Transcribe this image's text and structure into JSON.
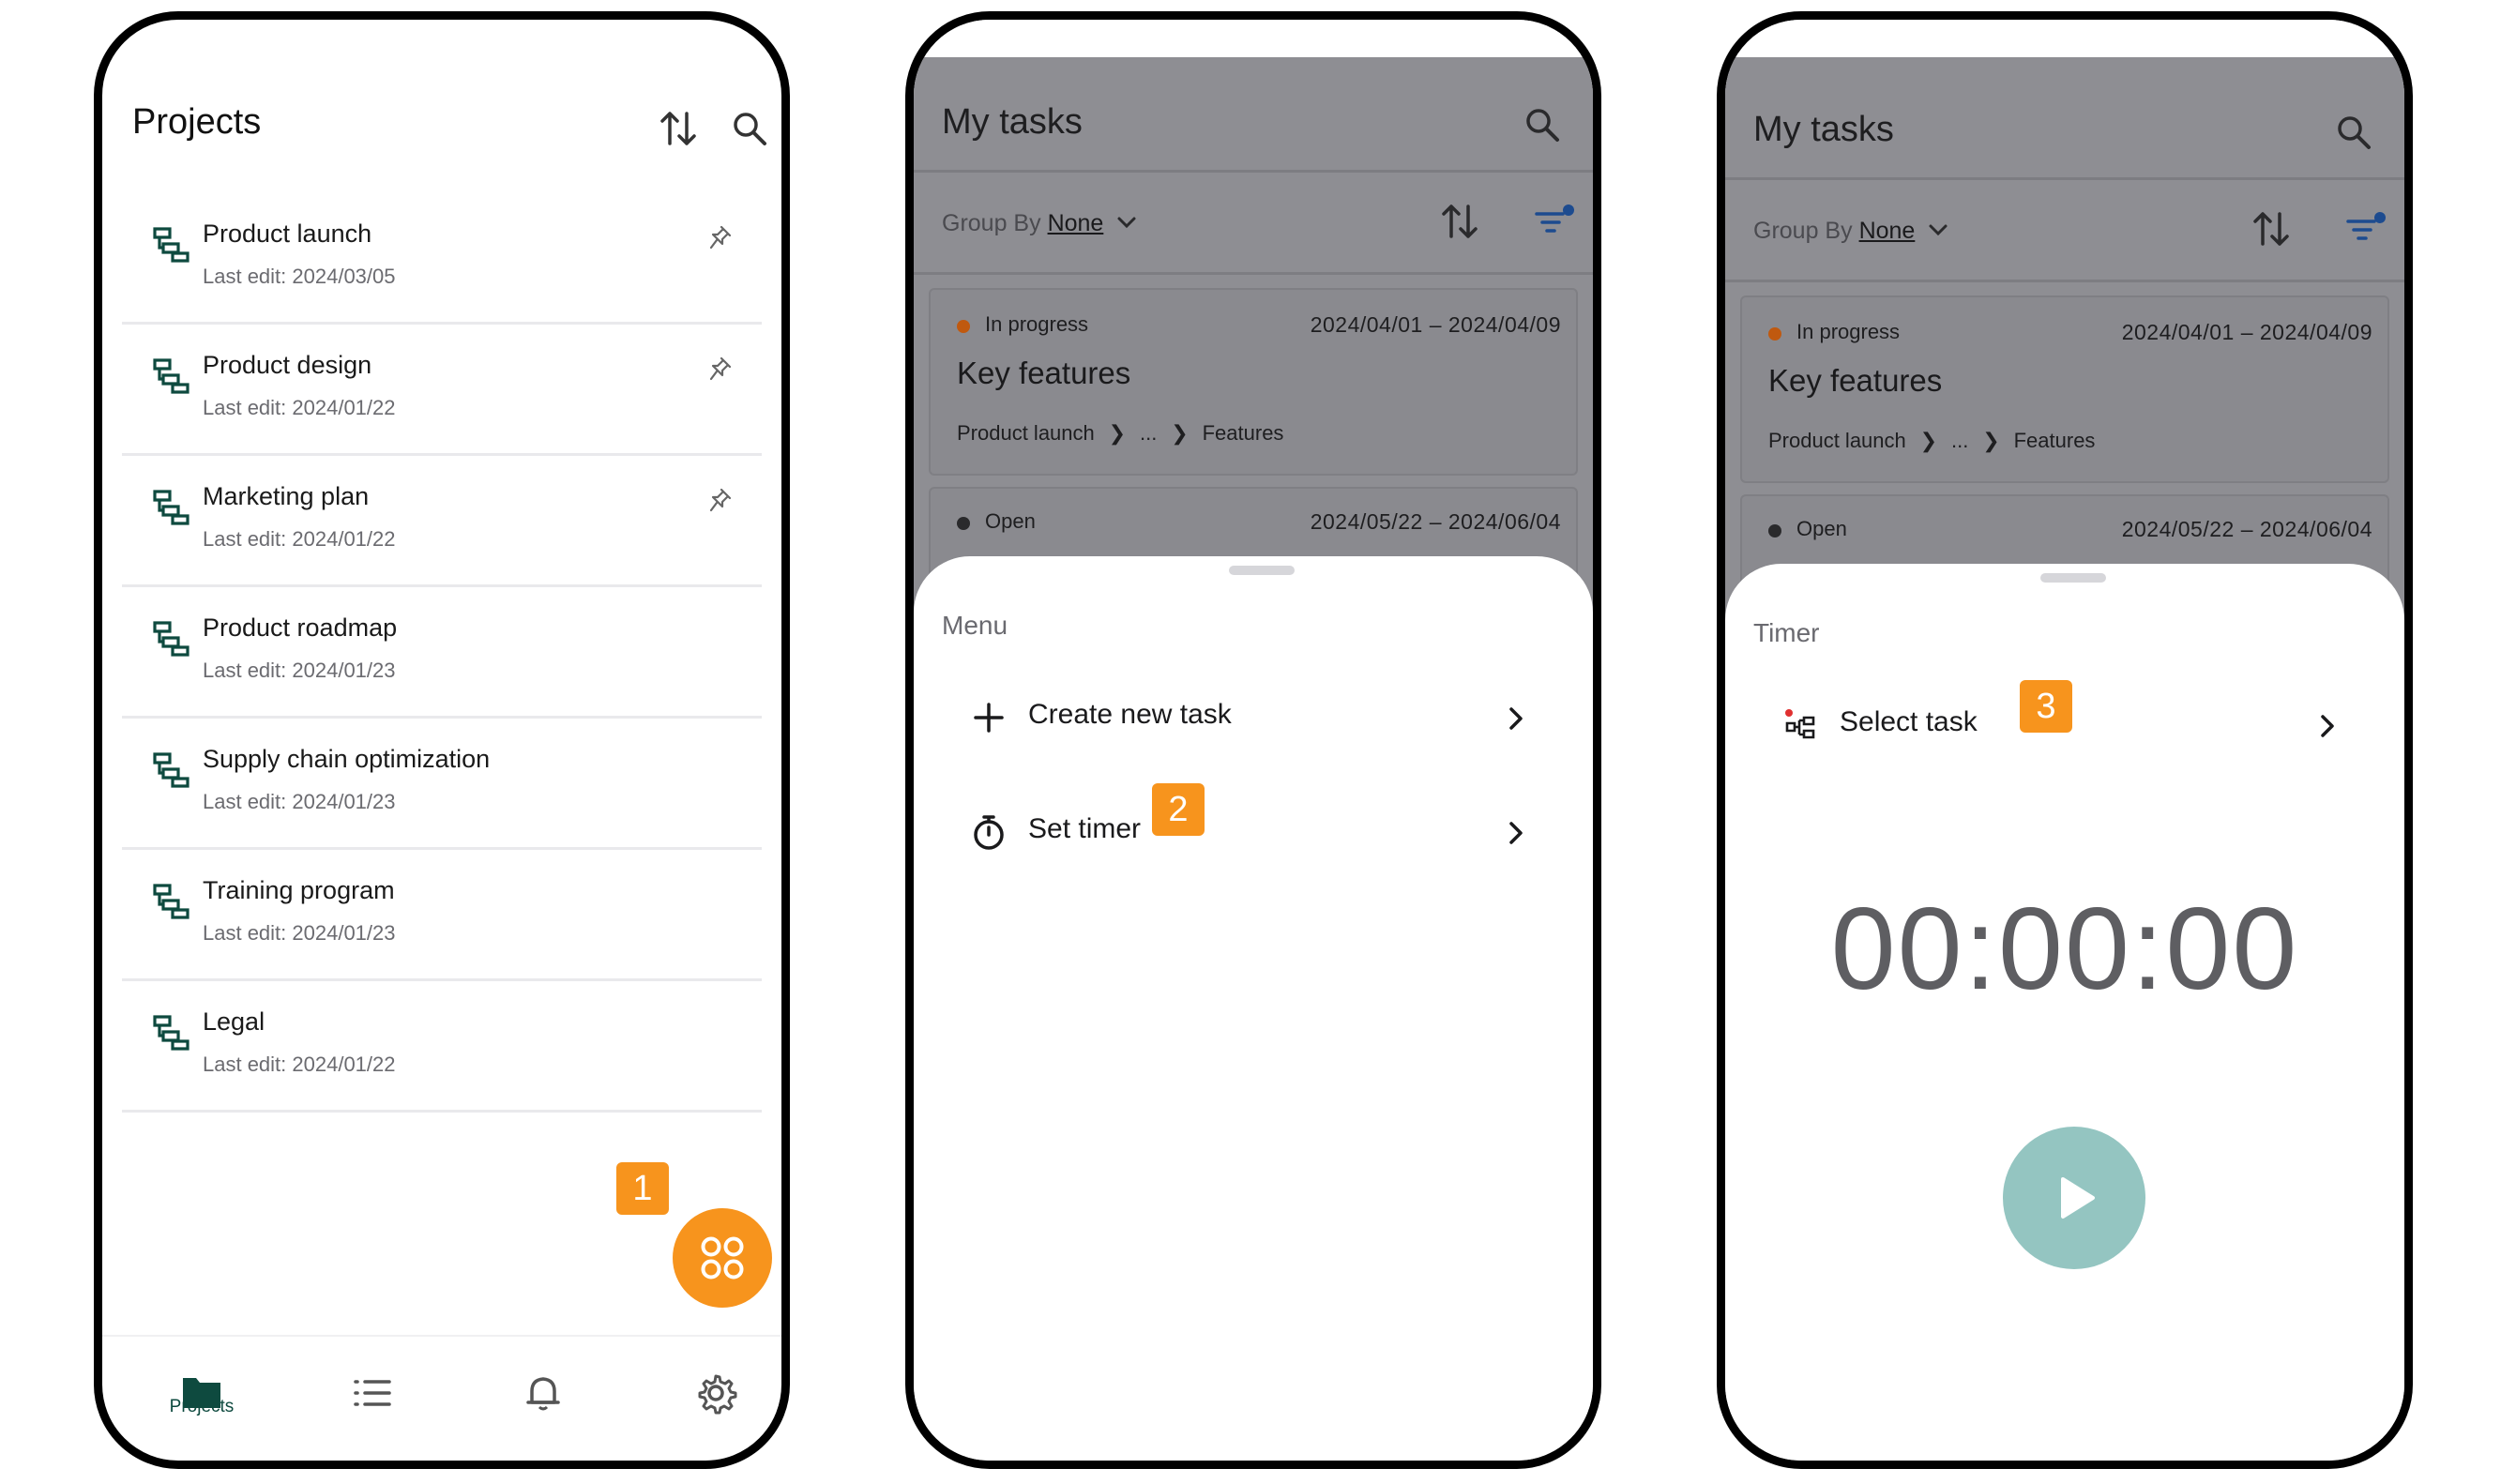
{
  "phone1": {
    "title": "Projects",
    "projects": [
      {
        "name": "Product launch",
        "last_edit": "Last edit: 2024/03/05",
        "pinned": true
      },
      {
        "name": "Product design",
        "last_edit": "Last edit: 2024/01/22",
        "pinned": true
      },
      {
        "name": "Marketing plan",
        "last_edit": "Last edit: 2024/01/22",
        "pinned": true
      },
      {
        "name": "Product roadmap",
        "last_edit": "Last edit: 2024/01/23",
        "pinned": false
      },
      {
        "name": "Supply chain optimization",
        "last_edit": "Last edit: 2024/01/23",
        "pinned": false
      },
      {
        "name": "Training program",
        "last_edit": "Last edit: 2024/01/23",
        "pinned": false
      },
      {
        "name": "Legal",
        "last_edit": "Last edit: 2024/01/22",
        "pinned": false
      }
    ],
    "badge": "1",
    "nav": {
      "projects_label": "Projects"
    }
  },
  "phone2": {
    "title": "My tasks",
    "group_by_label": "Group By",
    "group_by_value": "None",
    "task1": {
      "status": "In progress",
      "dates": "2024/04/01 – 2024/04/09",
      "title": "Key features",
      "crumb1": "Product launch",
      "crumb2": "...",
      "crumb3": "Features"
    },
    "task2": {
      "status": "Open",
      "dates": "2024/05/22 – 2024/06/04"
    },
    "sheet_label": "Menu",
    "menu_create": "Create new task",
    "menu_timer": "Set timer",
    "badge": "2"
  },
  "phone3": {
    "title": "My tasks",
    "group_by_label": "Group By",
    "group_by_value": "None",
    "task1": {
      "status": "In progress",
      "dates": "2024/04/01 – 2024/04/09",
      "title": "Key features",
      "crumb1": "Product launch",
      "crumb2": "...",
      "crumb3": "Features"
    },
    "task2": {
      "status": "Open",
      "dates": "2024/05/22 – 2024/06/04"
    },
    "sheet_label": "Timer",
    "select_task": "Select task",
    "badge": "3",
    "timer_value": "00:00:00"
  },
  "colors": {
    "accent_orange": "#f7941d",
    "brand_green": "#0e4a3f",
    "status_in_progress": "#c0590f",
    "status_open": "#2a2a2c",
    "filter_blue": "#1d4b8f",
    "play_teal": "#94c5c1"
  }
}
